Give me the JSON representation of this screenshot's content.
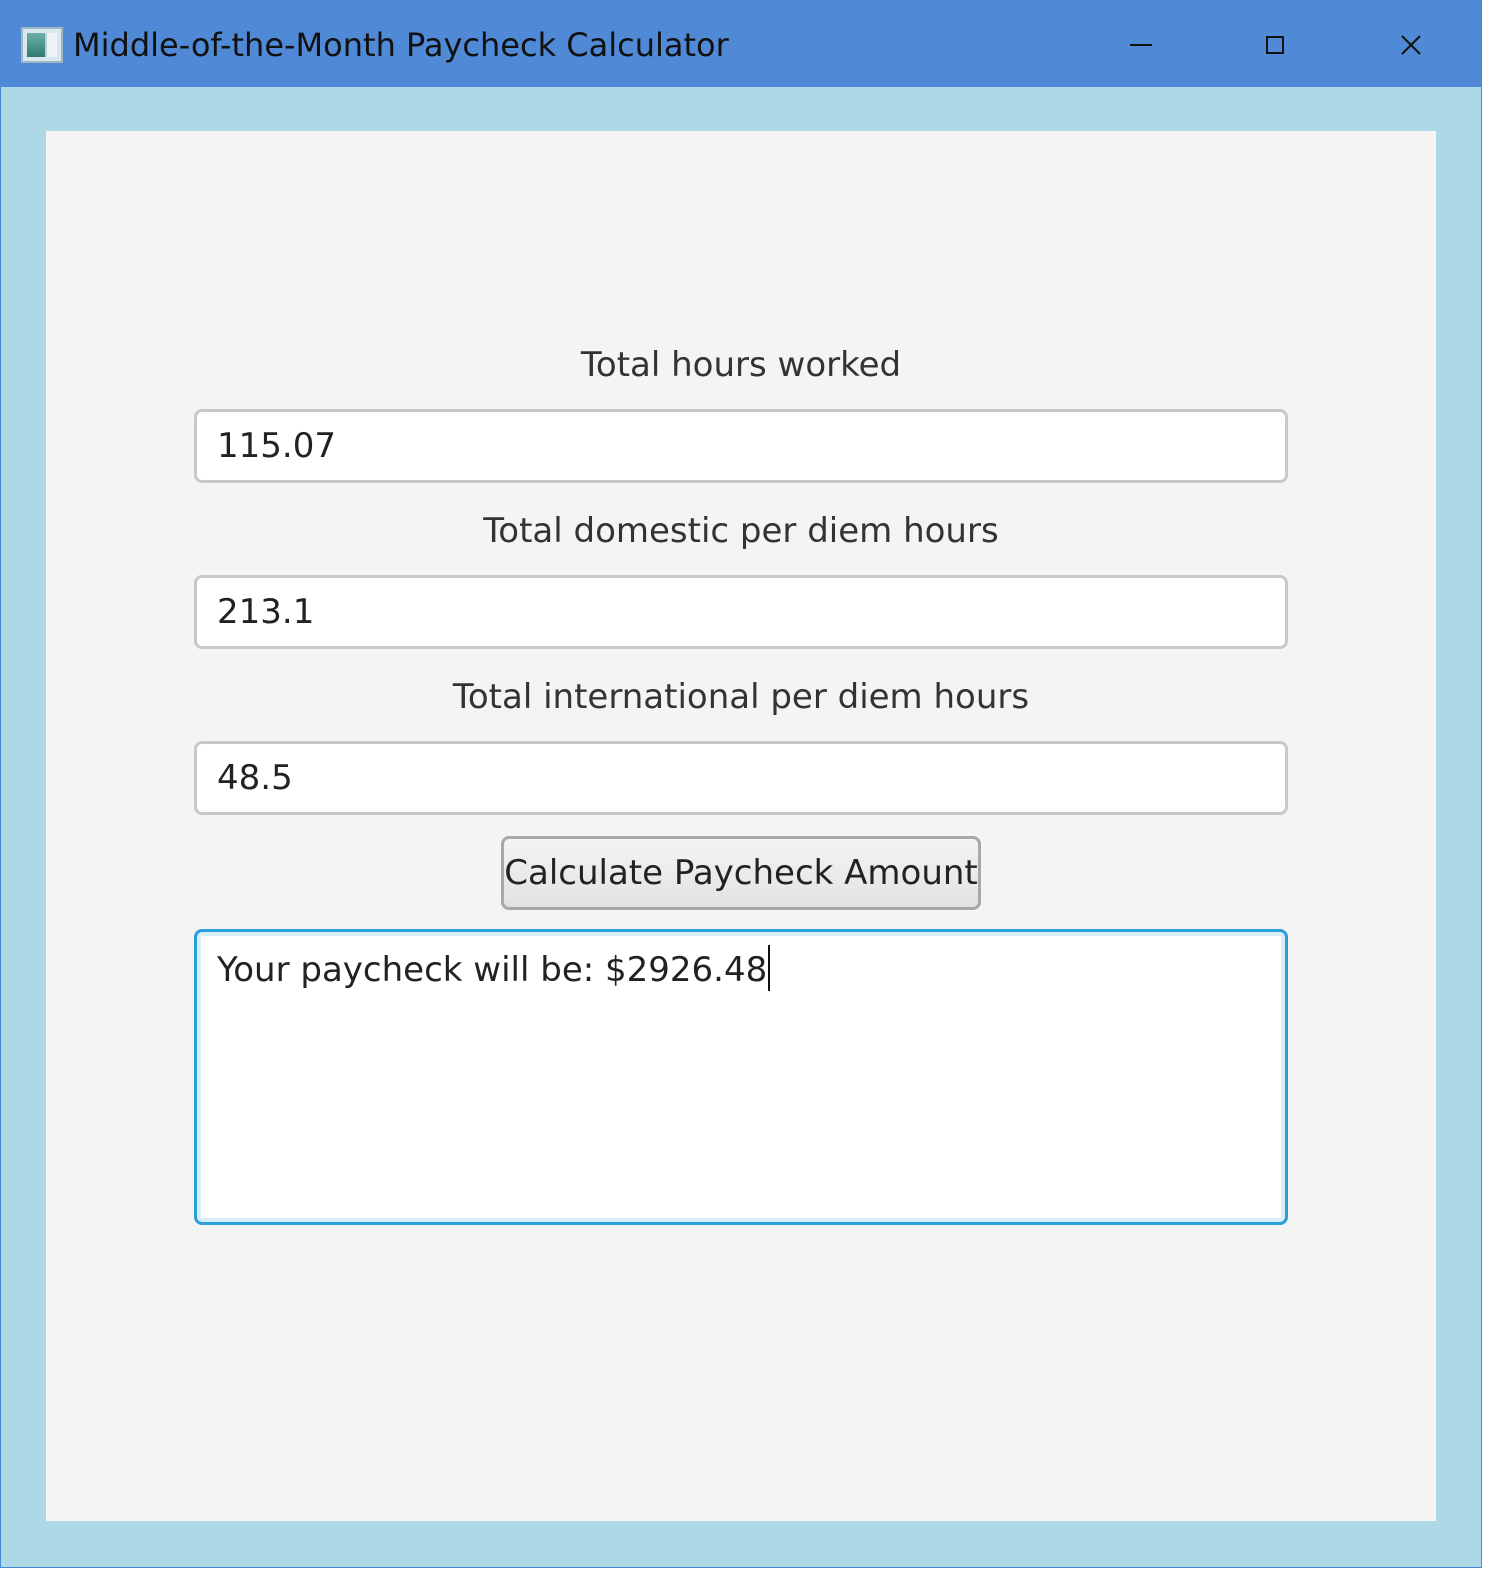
{
  "window": {
    "title": "Middle-of-the-Month Paycheck Calculator",
    "icons": {
      "app": "app-icon",
      "minimize": "minimize-icon",
      "maximize": "maximize-icon",
      "close": "close-icon"
    },
    "close_glyph": "✕"
  },
  "form": {
    "hours_label": "Total hours worked",
    "hours_value": "115.07",
    "domestic_label": "Total domestic per diem hours",
    "domestic_value": "213.1",
    "international_label": "Total international per diem hours",
    "international_value": "48.5",
    "calculate_label": "Calculate Paycheck Amount",
    "result_text": "Your paycheck will be: $2926.48"
  },
  "colors": {
    "titlebar": "#5089d6",
    "window_background": "#add8e6",
    "content_background": "#f4f4f4",
    "focus_border": "#2a9fd8"
  }
}
